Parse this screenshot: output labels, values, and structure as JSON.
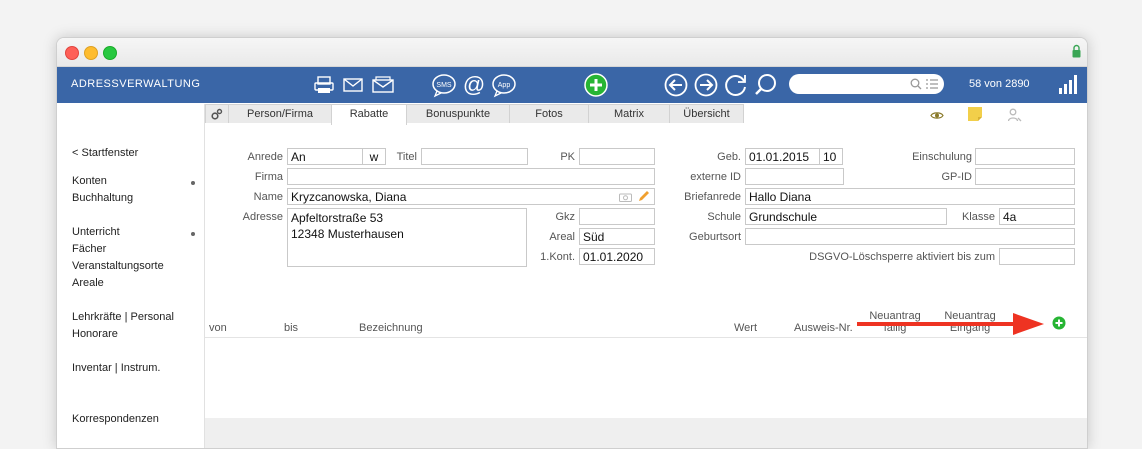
{
  "app_title": "ADRESSVERWALTUNG",
  "record_count": "58 von 2890",
  "search": {
    "placeholder": ""
  },
  "sidebar": {
    "back": "< Startfenster",
    "items": [
      "Konten",
      "Buchhaltung",
      "Unterricht",
      "Fächer",
      "Veranstaltungsorte",
      "Areale",
      "Lehrkräfte | Personal",
      "Honorare",
      "Inventar | Instrum.",
      "Korrespondenzen"
    ]
  },
  "tabs": [
    "Person/Firma",
    "Rabatte",
    "Bonuspunkte",
    "Fotos",
    "Matrix",
    "Übersicht"
  ],
  "active_tab": "Rabatte",
  "form": {
    "anrede_label": "Anrede",
    "anrede": "An",
    "w": "w",
    "titel_label": "Titel",
    "titel": "",
    "pk_label": "PK",
    "pk": "",
    "firma_label": "Firma",
    "firma": "",
    "name_label": "Name",
    "name": "Kryzcanowska, Diana",
    "adresse_label": "Adresse",
    "adresse_1": "Apfeltorstraße 53",
    "adresse_2": "12348 Musterhausen",
    "gkz_label": "Gkz",
    "gkz": "",
    "areal_label": "Areal",
    "areal": "Süd",
    "kont_label": "1.Kont.",
    "kont": "01.01.2020",
    "geb_label": "Geb.",
    "geb": "01.01.2015",
    "geb_age": "10",
    "einschulung_label": "Einschulung",
    "einschulung": "",
    "externe_label": "externe ID",
    "externe": "",
    "gpid_label": "GP-ID",
    "gpid": "",
    "briefanrede_label": "Briefanrede",
    "briefanrede": "Hallo Diana",
    "schule_label": "Schule",
    "schule": "Grundschule",
    "klasse_label": "Klasse",
    "klasse": "4a",
    "geburtsort_label": "Geburtsort",
    "geburtsort": "",
    "dsgvo_label": "DSGVO-Löschsperre aktiviert bis zum",
    "dsgvo": ""
  },
  "table": {
    "columns": {
      "von": "von",
      "bis": "bis",
      "bezeichnung": "Bezeichnung",
      "wert": "Wert",
      "ausweis": "Ausweis-Nr.",
      "neu1_top": "Neuantrag",
      "neu1_bottom": "fällig",
      "neu2_top": "Neuantrag",
      "neu2_bottom": "Eingang"
    },
    "rows": []
  },
  "colors": {
    "appbar": "#3a66a7",
    "accent_green": "#27b534",
    "arrow_red": "#ee3322"
  },
  "icons": [
    "printer-icon",
    "mail-icon",
    "mail-open-icon",
    "sms-icon",
    "at-icon",
    "app-icon",
    "add-icon",
    "back-icon",
    "forward-icon",
    "refresh-icon",
    "search-icon",
    "list-icon",
    "signal-icon",
    "gear-icon",
    "eye-icon",
    "note-icon",
    "user-icon",
    "camera-icon",
    "pencil-icon",
    "lock-icon"
  ]
}
